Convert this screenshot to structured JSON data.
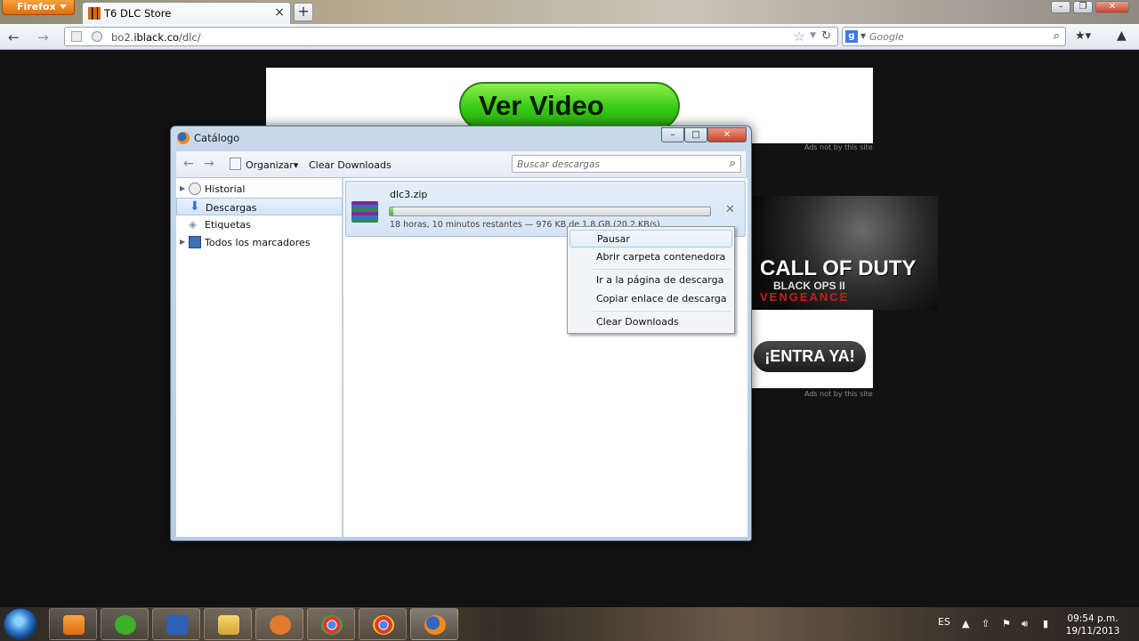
{
  "browser": {
    "app_button": "Firefox",
    "tab_title": "T6 DLC Store",
    "url_prefix": "bo2.",
    "url_domain": "iblack.co",
    "url_path": "/dlc/",
    "search_placeholder": "Google"
  },
  "page": {
    "video_button": "Ver Video",
    "ad_note": "Ads not by this site",
    "ad_title_line1": "CALL OF DUTY",
    "ad_title_line2": "BLACK OPS II",
    "ad_title_line3": "VENGEANCE",
    "ad_button": "¡ENTRA YA!"
  },
  "library": {
    "title": "Catálogo",
    "toolbar": {
      "organize_label": "Organizar",
      "clear_label": "Clear Downloads",
      "search_placeholder": "Buscar descargas"
    },
    "tree": [
      {
        "label": "Historial",
        "icon": "clock-icon"
      },
      {
        "label": "Descargas",
        "icon": "download-arrow-icon",
        "selected": true
      },
      {
        "label": "Etiquetas",
        "icon": "tag-icon"
      },
      {
        "label": "Todos los marcadores",
        "icon": "bookmarks-icon"
      }
    ],
    "download": {
      "filename": "dlc3.zip",
      "progress_fraction": 0.001,
      "status": "18 horas, 10 minutos restantes — 976 KB de 1,8 GB (20,2 KB/s)"
    }
  },
  "context_menu": {
    "items": [
      "Pausar",
      "Abrir carpeta contenedora",
      "Ir a la página de descarga",
      "Copiar enlace de descarga",
      "Clear Downloads"
    ]
  },
  "taskbar": {
    "language": "ES",
    "time": "09:54 p.m.",
    "date": "19/11/2013",
    "apps": [
      "media-player-icon",
      "utorrent-icon",
      "vlc-icon",
      "folder-icon",
      "sandbox-icon",
      "chrome-icon",
      "chrome-icon",
      "firefox-icon"
    ]
  },
  "colors": {
    "video_button_green": "#37c916",
    "ad_red": "#d21b12",
    "firefox_orange": "#e06c0c"
  }
}
